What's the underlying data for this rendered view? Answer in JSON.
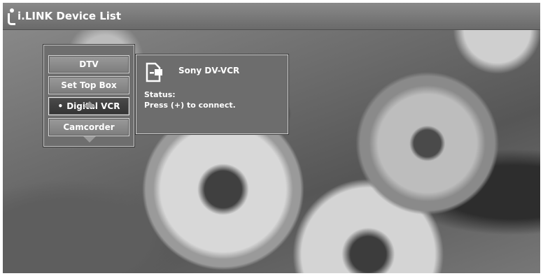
{
  "window": {
    "title": "i.LINK Device List",
    "logo_icon": "ilink-logo-icon"
  },
  "device_list": {
    "items": [
      {
        "label": "DTV",
        "selected": false
      },
      {
        "label": "Set Top Box",
        "selected": false
      },
      {
        "label": "Digital VCR",
        "selected": true,
        "bullet": "•"
      },
      {
        "label": "Camcorder",
        "selected": false
      }
    ],
    "scroll_up_icon": "up-arrow-icon",
    "scroll_down_icon": "down-arrow-icon"
  },
  "device_info": {
    "icon": "vcr-device-icon",
    "name": "Sony DV-VCR",
    "status_label": "Status:",
    "status_text": "Press (+) to connect."
  },
  "colors": {
    "title_bar": "#7a7a7a",
    "panel": "#6e6e6e",
    "selected_button": "#3e3e3e",
    "text": "#ffffff"
  }
}
